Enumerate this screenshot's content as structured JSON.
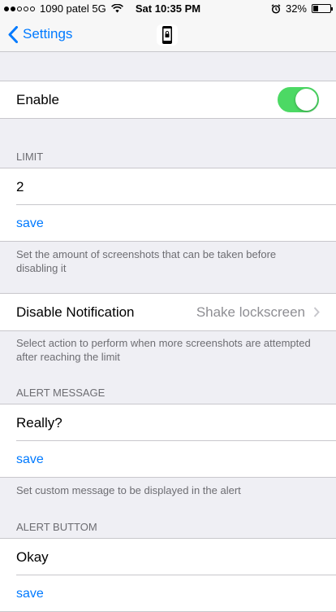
{
  "status_bar": {
    "carrier": "1090 patel 5G",
    "time": "Sat 10:35 PM",
    "battery": "32%",
    "battery_level": 0.32,
    "signal_bars": 2
  },
  "nav": {
    "back_label": "Settings",
    "title_icon": "phone-lock-icon"
  },
  "enable": {
    "label": "Enable",
    "on": true
  },
  "limit": {
    "header": "LIMIT",
    "value": "2",
    "save_label": "save",
    "footer": "Set the amount of screenshots that can be taken before disabling it"
  },
  "disable_notification": {
    "label": "Disable Notification",
    "value": "Shake lockscreen",
    "footer": "Select action to perform when more screenshots are attempted after reaching the limit"
  },
  "alert_message": {
    "header": "ALERT MESSAGE",
    "value": "Really?",
    "save_label": "save",
    "footer": "Set custom message to be displayed in the alert"
  },
  "alert_button": {
    "header": "ALERT BUTTOM",
    "value": "Okay",
    "save_label": "save"
  },
  "colors": {
    "accent": "#007aff",
    "toggle_on": "#4cd964",
    "background": "#efeff4"
  }
}
